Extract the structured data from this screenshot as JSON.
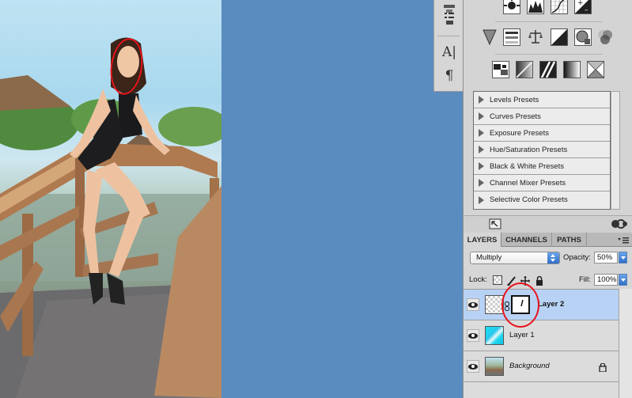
{
  "adjustments": {
    "presets": [
      "Levels Presets",
      "Curves Presets",
      "Exposure Presets",
      "Hue/Saturation Presets",
      "Black & White Presets",
      "Channel Mixer Presets",
      "Selective Color Presets"
    ]
  },
  "layers_panel": {
    "tabs": [
      "LAYERS",
      "CHANNELS",
      "PATHS"
    ],
    "blend_mode": "Multiply",
    "opacity_label": "Opacity:",
    "opacity_value": "50%",
    "lock_label": "Lock:",
    "fill_label": "Fill:",
    "fill_value": "100%",
    "layers": [
      {
        "name": "Layer 2",
        "selected": true
      },
      {
        "name": "Layer 1",
        "selected": false
      },
      {
        "name": "Background",
        "selected": false
      }
    ]
  },
  "colors": {
    "workspace": "#5b8cbf",
    "annotation": "#e8141c",
    "selected_layer": "#b8d2f5"
  }
}
